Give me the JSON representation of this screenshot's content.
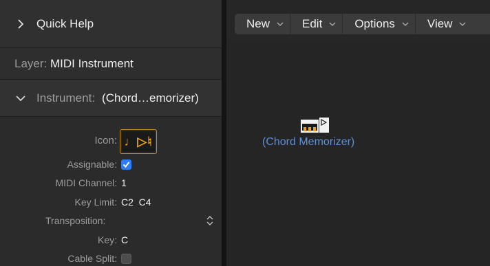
{
  "inspector": {
    "quick_help": {
      "label": "Quick Help",
      "icon": "chevron-right-icon"
    },
    "layer": {
      "key": "Layer:",
      "value": "MIDI Instrument"
    },
    "instrument": {
      "key": "Instrument:",
      "value": "(Chord…emorizer)",
      "icon": "chevron-down-icon"
    },
    "params": {
      "icon_label": "Icon:",
      "icon_glyph": "♩▷♮",
      "assignable_label": "Assignable:",
      "assignable_checked": true,
      "midi_channel_label": "MIDI Channel:",
      "midi_channel_value": "1",
      "key_limit_label": "Key Limit:",
      "key_limit_value": "C2  C4",
      "transposition_label": "Transposition:",
      "key_label": "Key:",
      "key_value": "C",
      "cable_split_label": "Cable Split:",
      "cable_split_checked": false
    }
  },
  "toolbar": {
    "menus": [
      {
        "label": "New"
      },
      {
        "label": "Edit"
      },
      {
        "label": "Options"
      },
      {
        "label": "View"
      }
    ]
  },
  "canvas": {
    "object_label": "(Chord Memorizer)",
    "object_screen_text": "▪▪▪"
  },
  "colors": {
    "accent_blue": "#2f7cf6",
    "object_label": "#5e8fd6",
    "icon_orange": "#e8a020"
  }
}
